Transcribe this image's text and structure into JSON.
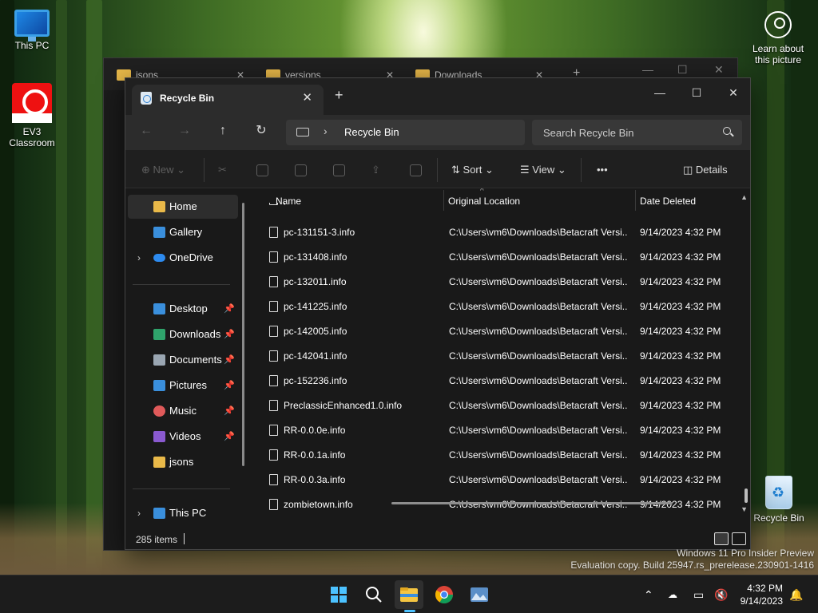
{
  "desktop": {
    "icons": [
      {
        "label": "This PC"
      },
      {
        "label": "EV3 Classroom"
      },
      {
        "label": "Learn about this picture"
      },
      {
        "label": "Recycle Bin"
      }
    ]
  },
  "background_window": {
    "tabs": [
      {
        "label": "jsons"
      },
      {
        "label": "versions"
      },
      {
        "label": "Downloads"
      }
    ]
  },
  "window": {
    "tab_title": "Recycle Bin",
    "tab_close": "✕",
    "new_tab": "+",
    "controls": {
      "minimize": "—",
      "maximize": "☐",
      "close": "✕"
    },
    "address": {
      "crumb": "Recycle Bin",
      "separator": "›"
    },
    "search": {
      "placeholder": "Search Recycle Bin"
    },
    "commands": {
      "new": "New",
      "sort": "Sort",
      "view": "View",
      "more": "•••",
      "details": "Details"
    }
  },
  "sidebar": {
    "items": [
      {
        "label": "Home"
      },
      {
        "label": "Gallery"
      },
      {
        "label": "OneDrive"
      },
      {
        "label": "Desktop"
      },
      {
        "label": "Downloads"
      },
      {
        "label": "Documents"
      },
      {
        "label": "Pictures"
      },
      {
        "label": "Music"
      },
      {
        "label": "Videos"
      },
      {
        "label": "jsons"
      },
      {
        "label": "This PC"
      }
    ]
  },
  "table": {
    "columns": {
      "name": "Name",
      "location": "Original Location",
      "date": "Date Deleted"
    },
    "rows": [
      {
        "name": "pc-131151-1.info",
        "location": "C:\\Users\\vm6\\Downloads\\Betacraft Versi...",
        "date": "9/14/2023 4:32 PM"
      },
      {
        "name": "pc-131151-3.info",
        "location": "C:\\Users\\vm6\\Downloads\\Betacraft Versi...",
        "date": "9/14/2023 4:32 PM"
      },
      {
        "name": "pc-131408.info",
        "location": "C:\\Users\\vm6\\Downloads\\Betacraft Versi...",
        "date": "9/14/2023 4:32 PM"
      },
      {
        "name": "pc-132011.info",
        "location": "C:\\Users\\vm6\\Downloads\\Betacraft Versi...",
        "date": "9/14/2023 4:32 PM"
      },
      {
        "name": "pc-141225.info",
        "location": "C:\\Users\\vm6\\Downloads\\Betacraft Versi...",
        "date": "9/14/2023 4:32 PM"
      },
      {
        "name": "pc-142005.info",
        "location": "C:\\Users\\vm6\\Downloads\\Betacraft Versi...",
        "date": "9/14/2023 4:32 PM"
      },
      {
        "name": "pc-142041.info",
        "location": "C:\\Users\\vm6\\Downloads\\Betacraft Versi...",
        "date": "9/14/2023 4:32 PM"
      },
      {
        "name": "pc-152236.info",
        "location": "C:\\Users\\vm6\\Downloads\\Betacraft Versi...",
        "date": "9/14/2023 4:32 PM"
      },
      {
        "name": "PreclassicEnhanced1.0.info",
        "location": "C:\\Users\\vm6\\Downloads\\Betacraft Versi...",
        "date": "9/14/2023 4:32 PM"
      },
      {
        "name": "RR-0.0.0e.info",
        "location": "C:\\Users\\vm6\\Downloads\\Betacraft Versi...",
        "date": "9/14/2023 4:32 PM"
      },
      {
        "name": "RR-0.0.1a.info",
        "location": "C:\\Users\\vm6\\Downloads\\Betacraft Versi...",
        "date": "9/14/2023 4:32 PM"
      },
      {
        "name": "RR-0.0.3a.info",
        "location": "C:\\Users\\vm6\\Downloads\\Betacraft Versi...",
        "date": "9/14/2023 4:32 PM"
      },
      {
        "name": "zombietown.info",
        "location": "C:\\Users\\vm6\\Downloads\\Betacraft Versi...",
        "date": "9/14/2023 4:32 PM"
      }
    ]
  },
  "status": {
    "item_count": "285 items"
  },
  "watermark": {
    "line1": "Windows 11 Pro Insider Preview",
    "line2": "Evaluation copy. Build 25947.rs_prerelease.230901-1416"
  },
  "taskbar": {
    "time": "4:32 PM",
    "date": "9/14/2023"
  },
  "colors": {
    "accent": "#4cc2ff",
    "folder": "#e9b949",
    "window_bg": "#191919"
  }
}
